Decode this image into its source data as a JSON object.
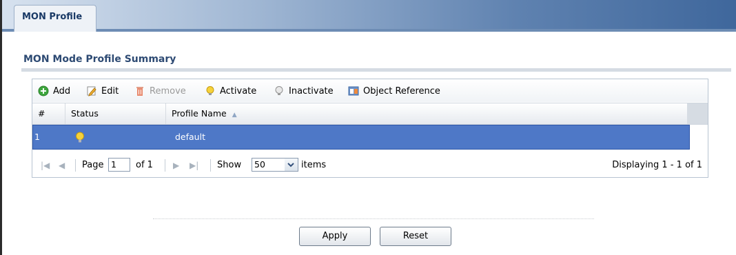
{
  "tab": {
    "label": "MON Profile"
  },
  "section": {
    "title": "MON Mode Profile Summary"
  },
  "toolbar": {
    "add": "Add",
    "edit": "Edit",
    "remove": "Remove",
    "activate": "Activate",
    "inactivate": "Inactivate",
    "object_reference": "Object Reference"
  },
  "table": {
    "columns": [
      "#",
      "Status",
      "Profile Name"
    ],
    "sort_indicator": "▲",
    "rows": [
      {
        "index": "1",
        "status_icon": "bulb-on-icon",
        "profile_name": "default"
      }
    ]
  },
  "pager": {
    "page_label": "Page",
    "page_value": "1",
    "of_label": "of 1",
    "show_label": "Show",
    "show_value": "50",
    "items_label": "items",
    "displaying": "Displaying 1 - 1 of 1"
  },
  "buttons": {
    "apply": "Apply",
    "reset": "Reset"
  },
  "colors": {
    "selected_row": "#4e78c7",
    "title": "#2d4a73"
  }
}
